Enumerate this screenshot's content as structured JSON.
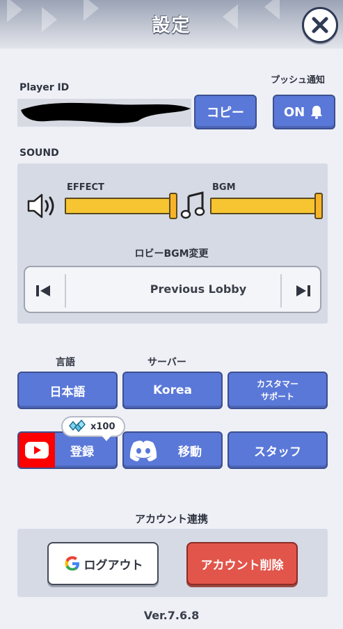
{
  "header": {
    "title": "設定"
  },
  "player": {
    "label": "Player ID",
    "copy_label": "コピー"
  },
  "push": {
    "label": "プッシュ通知",
    "toggle_label": "ON"
  },
  "sound": {
    "section_label": "SOUND",
    "effect_label": "EFFECT",
    "bgm_label": "BGM",
    "effect_level": 1.0,
    "bgm_level": 1.0,
    "lobby_bgm_label": "ロビーBGM変更",
    "current_track": "Previous Lobby"
  },
  "settings": {
    "language_label": "言語",
    "language_value": "日本語",
    "server_label": "サーバー",
    "server_value": "Korea",
    "support_line1": "カスタマー",
    "support_line2": "サポート"
  },
  "social": {
    "youtube_label": "登録",
    "reward_text": "x100",
    "discord_label": "移動",
    "staff_label": "スタッフ"
  },
  "account": {
    "section_label": "アカウント連携",
    "logout_label": "ログアウト",
    "delete_label": "アカウント削除"
  },
  "footer": {
    "version": "Ver.7.6.8"
  },
  "colors": {
    "button_blue": "#5a78d8",
    "slider_yellow": "#f7c531",
    "delete_red": "#e2554b",
    "youtube_red": "#ff0000"
  }
}
